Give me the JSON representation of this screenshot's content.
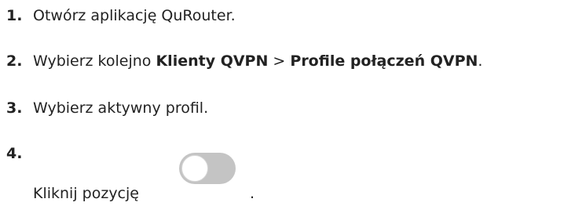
{
  "steps": [
    {
      "number": "1.",
      "text": "Otwórz aplikację QuRouter."
    },
    {
      "number": "2.",
      "prefix": "Wybierz kolejno ",
      "bold1": "Klienty QVPN",
      "separator": " > ",
      "bold2": "Profile połączeń QVPN",
      "suffix": "."
    },
    {
      "number": "3.",
      "text": "Wybierz aktywny profil."
    },
    {
      "number": "4.",
      "text": "Kliknij pozycję",
      "suffix": "."
    }
  ],
  "toggle": {
    "state": "off",
    "track_color": "#c4c4c4",
    "knob_color": "#ffffff"
  }
}
